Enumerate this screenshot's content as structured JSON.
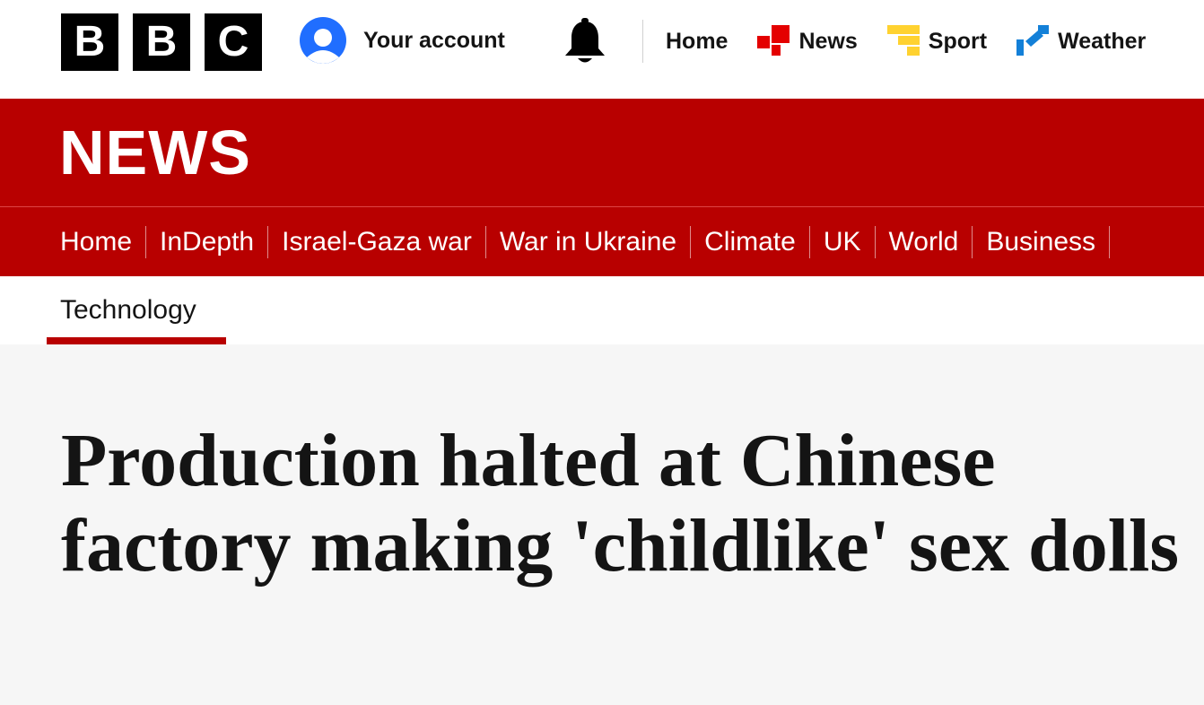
{
  "bbc": {
    "logo_letters": [
      "B",
      "B",
      "C"
    ],
    "account_label": "Your account",
    "nav": [
      {
        "label": "Home",
        "icon": "none"
      },
      {
        "label": "News",
        "icon": "news-icon",
        "color": "#e40000"
      },
      {
        "label": "Sport",
        "icon": "sport-icon",
        "color": "#ffd230"
      },
      {
        "label": "Weather",
        "icon": "weather-icon",
        "color": "#1380d8"
      }
    ]
  },
  "news": {
    "brand": "NEWS",
    "nav": [
      "Home",
      "InDepth",
      "Israel-Gaza war",
      "War in Ukraine",
      "Climate",
      "UK",
      "World",
      "Business"
    ]
  },
  "section": {
    "label": "Technology"
  },
  "article": {
    "headline": "Production halted at Chinese factory making 'childlike' sex dolls"
  },
  "colors": {
    "accent": "#b80000",
    "account_blue": "#206eff"
  }
}
